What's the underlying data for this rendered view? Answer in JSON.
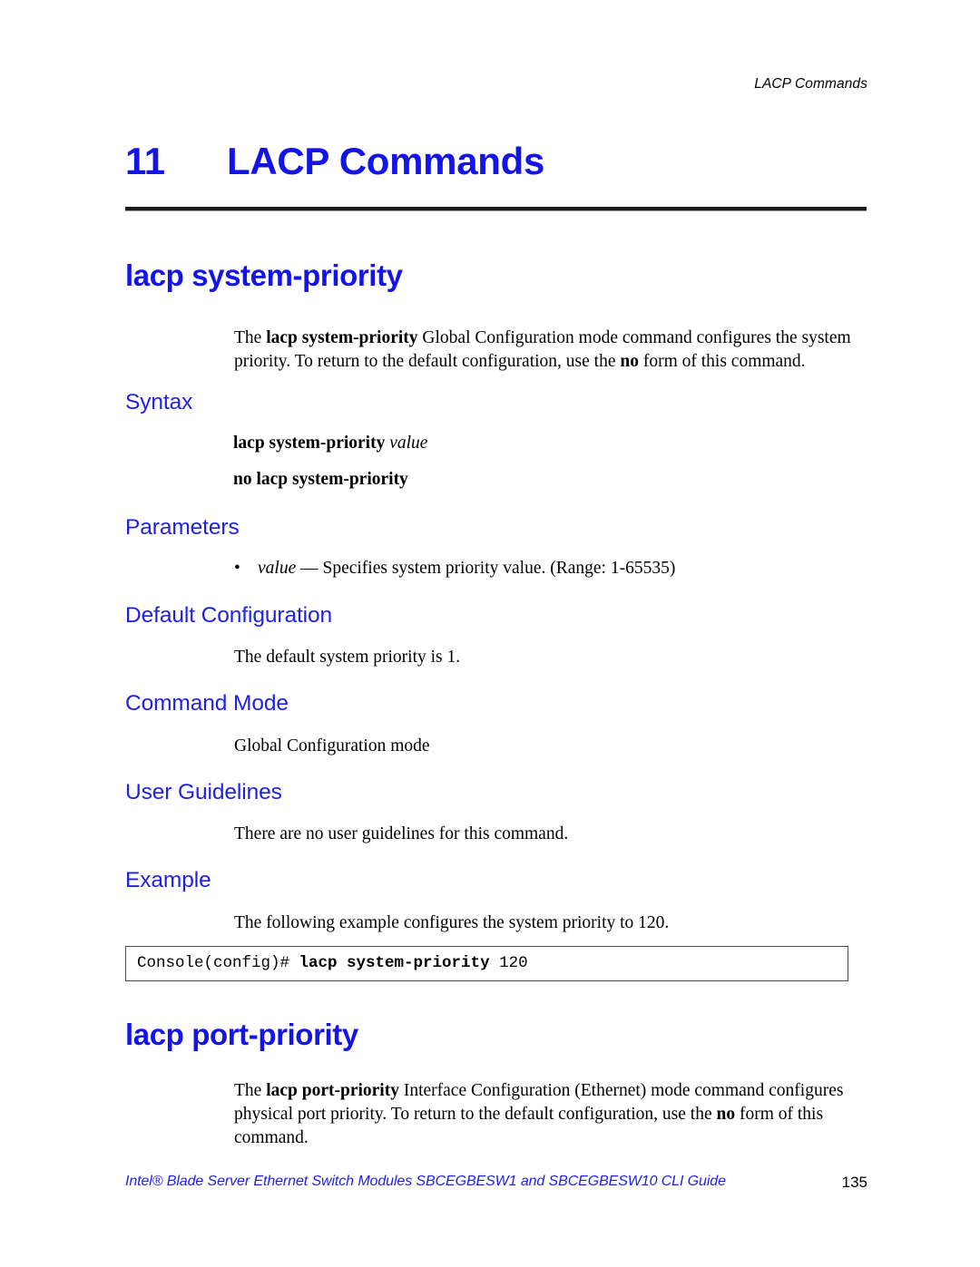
{
  "header": {
    "running_head": "LACP Commands"
  },
  "chapter": {
    "number": "11",
    "title": "LACP Commands"
  },
  "commands": [
    {
      "name": "lacp system-priority",
      "intro_prefix": "The ",
      "intro_bold": "lacp system-priority",
      "intro_mid": " Global Configuration mode command configures the system priority. To return to the default configuration, use the ",
      "intro_bold2": "no",
      "intro_suffix": " form of this command.",
      "sections": {
        "syntax_label": "Syntax",
        "syntax_line1_cmd": "lacp system-priority",
        "syntax_line1_arg": "value",
        "syntax_line2": "no lacp system-priority",
        "parameters_label": "Parameters",
        "parameter_name": "value",
        "parameter_desc": " — Specifies system priority value. (Range: 1-65535)",
        "default_label": "Default Configuration",
        "default_text": "The default system priority is 1.",
        "mode_label": "Command Mode",
        "mode_text": "Global Configuration mode",
        "guidelines_label": "User Guidelines",
        "guidelines_text": "There are no user guidelines for this command.",
        "example_label": "Example",
        "example_text": "The following example configures the system priority to 120."
      },
      "code": {
        "prompt": "Console(config)# ",
        "command": "lacp system-priority",
        "argument": " 120"
      }
    },
    {
      "name": "lacp port-priority",
      "intro_prefix": "The ",
      "intro_bold": "lacp port-priority",
      "intro_mid": " Interface Configuration (Ethernet) mode command configures physical port priority. To return to the default configuration, use the ",
      "intro_bold2": "no",
      "intro_suffix": " form of this command."
    }
  ],
  "footer": {
    "text": "Intel® Blade Server Ethernet Switch Modules SBCEGBESW1 and SBCEGBESW10 CLI Guide",
    "page_number": "135"
  },
  "colors": {
    "heading_blue": "#1414e6",
    "section_blue": "#1f1fe8",
    "rule_black": "#1a1a1a"
  }
}
